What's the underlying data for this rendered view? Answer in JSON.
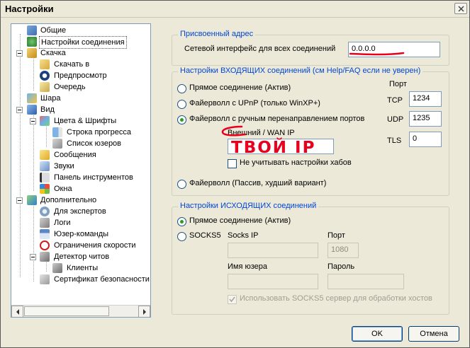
{
  "window": {
    "title": "Настройки"
  },
  "tree": {
    "items": [
      {
        "label": "Общие"
      },
      {
        "label": "Настройки соединения"
      },
      {
        "label": "Скачка"
      },
      {
        "label": "Скачать в"
      },
      {
        "label": "Предпросмотр"
      },
      {
        "label": "Очередь"
      },
      {
        "label": "Шара"
      },
      {
        "label": "Вид"
      },
      {
        "label": "Цвета & Шрифты"
      },
      {
        "label": "Строка прогресса"
      },
      {
        "label": "Список юзеров"
      },
      {
        "label": "Сообщения"
      },
      {
        "label": "Звуки"
      },
      {
        "label": "Панель инструментов"
      },
      {
        "label": "Окна"
      },
      {
        "label": "Дополнительно"
      },
      {
        "label": "Для экспертов"
      },
      {
        "label": "Логи"
      },
      {
        "label": "Юзер-команды"
      },
      {
        "label": "Ограничения скорости"
      },
      {
        "label": "Детектор читов"
      },
      {
        "label": "Клиенты"
      },
      {
        "label": "Сертификат безопасности"
      }
    ]
  },
  "assigned": {
    "title": "Присвоенный адрес",
    "iface_label": "Сетевой интерфейс для всех соединений",
    "iface_value": "0.0.0.0"
  },
  "incoming": {
    "title": "Настройки ВХОДЯЩИХ соединений (см Help/FAQ если не уверен)",
    "port_header": "Порт",
    "options": [
      {
        "label": "Прямое соединение (Актив)",
        "checked": false
      },
      {
        "label": "Файерволл с UPnP (только WinXP+)",
        "checked": false
      },
      {
        "label": "Файерволл с ручным перенаправлением портов",
        "checked": true
      },
      {
        "label": "Файерволл (Пассив, худший вариант)",
        "checked": false
      }
    ],
    "tcp_label": "TCP",
    "tcp_value": "1234",
    "udp_label": "UDP",
    "udp_value": "1235",
    "tls_label": "TLS",
    "tls_value": "0",
    "wan_label": "Внешний / WAN IP",
    "wan_value": "",
    "ignore_hubs_label": "Не учитывать настройки хабов",
    "handwritten_note": "ТВОЙ IP"
  },
  "outgoing": {
    "title": "Настройки ИСХОДЯЩИХ соединений",
    "direct_label": "Прямое соединение (Актив)",
    "socks_label": "SOCKS5",
    "socks_ip_label": "Socks IP",
    "socks_ip_value": "",
    "port_label": "Порт",
    "port_value": "1080",
    "user_label": "Имя юзера",
    "user_value": "",
    "pass_label": "Пароль",
    "pass_value": "",
    "use_socks_label": "Использовать SOCKS5 сервер для обработки хостов"
  },
  "buttons": {
    "ok": "OK",
    "cancel": "Отмена"
  },
  "colors": {
    "group_title": "#0046d5",
    "scribble": "#e8001c",
    "radio_dot": "#21a121"
  }
}
